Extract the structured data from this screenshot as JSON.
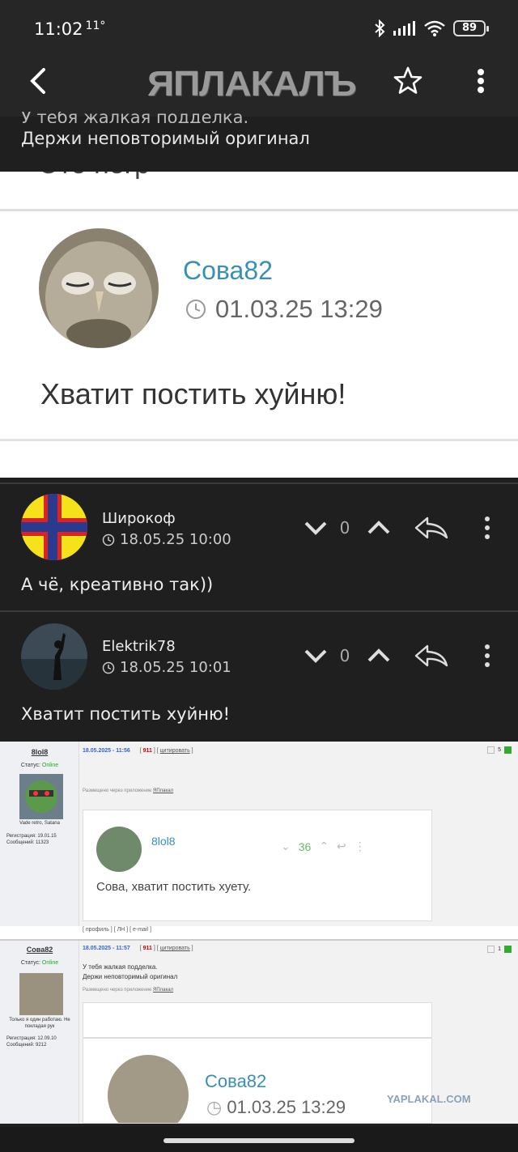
{
  "status": {
    "time": "11:02",
    "temp": "11°",
    "battery": "89"
  },
  "header": {
    "logo": "ЯПЛАКАЛЪ"
  },
  "quoted": {
    "line1": "У тебя жалкая подделка.",
    "line2": "Держи неповторимый оригинал",
    "image": {
      "author": "Сова82",
      "date": "01.03.25 13:29",
      "text": "Хватит постить хуйню!"
    }
  },
  "comments": [
    {
      "author": "Широкоф",
      "date": "18.05.25 10:00",
      "votes": "0",
      "text": "А чё, креативно так))"
    },
    {
      "author": "Elektrik78",
      "date": "18.05.25 10:01",
      "votes": "0",
      "text": "Хватит постить хуйню!"
    }
  ],
  "shot": {
    "p1": {
      "user": "8lol8",
      "date": "18.05.2025 - 11:56",
      "num": "911",
      "cite": "цитировать",
      "status_label": "Статус:",
      "status": "Online",
      "motto": "Vade retro, Satana",
      "reg": "Регистрация: 19.01.15",
      "msgs": "Сообщений: 11323",
      "via": "Размещено через приложение",
      "app": "ЯПлакал",
      "count": "5",
      "inner": {
        "user": "8lol8",
        "votes": "36",
        "text": "Сова, хватит постить хуету."
      }
    },
    "links": "[ профиль ] [ ЛН ] [ e-mail ]",
    "p2": {
      "user": "Сова82",
      "date": "18.05.2025 - 11:57",
      "num": "911",
      "cite": "цитировать",
      "status_label": "Статус:",
      "status": "Online",
      "motto": "Только я один работаю. Не покладая рук",
      "reg": "Регистрация: 12.09.10",
      "msgs": "Сообщений: 9212",
      "line1": "У тебя жалкая подделка.",
      "line2": "Держи неповторимый оригинал",
      "via": "Размещено через приложение",
      "app": "ЯПлакал",
      "count": "1",
      "inner": {
        "user": "Сова82",
        "date": "01.03.25 13:29"
      }
    },
    "watermark": "YAPLAKAL.COM"
  }
}
